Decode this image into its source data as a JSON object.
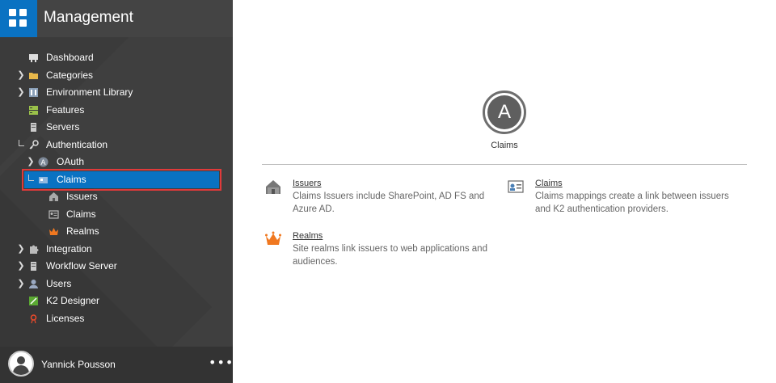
{
  "header": {
    "title": "Management"
  },
  "nav": [
    {
      "label": "Dashboard"
    },
    {
      "label": "Categories"
    },
    {
      "label": "Environment Library"
    },
    {
      "label": "Features"
    },
    {
      "label": "Servers"
    },
    {
      "label": "Authentication"
    },
    {
      "label": "OAuth"
    },
    {
      "label": "Claims"
    },
    {
      "label": "Issuers"
    },
    {
      "label": "Claims"
    },
    {
      "label": "Realms"
    },
    {
      "label": "Integration"
    },
    {
      "label": "Workflow Server"
    },
    {
      "label": "Users"
    },
    {
      "label": "K2 Designer"
    },
    {
      "label": "Licenses"
    }
  ],
  "footer": {
    "user_name": "Yannick Pousson",
    "more_label": "•••"
  },
  "main": {
    "avatar_letter": "A",
    "section_title": "Claims",
    "cards": [
      {
        "title": "Issuers",
        "desc": "Claims Issuers include SharePoint, AD FS and Azure AD."
      },
      {
        "title": "Claims",
        "desc": "Claims mappings create a link between issuers and K2 authentication providers."
      },
      {
        "title": "Realms",
        "desc": "Site realms link issuers to web applications and audiences."
      }
    ]
  },
  "colors": {
    "accent": "#0a72c2",
    "sidebar": "#3b3b3b",
    "highlight_border": "#e03a3a",
    "realms_icon": "#f07820"
  }
}
